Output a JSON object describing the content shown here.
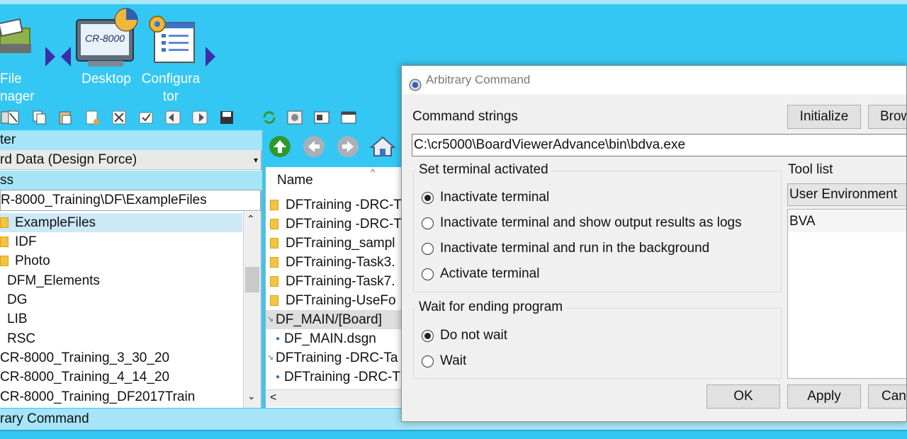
{
  "launcher": {
    "file_manager_label_line1": "File",
    "file_manager_label_line2": "nager",
    "desktop_label": "Desktop",
    "desktop_screen_text": "CR-8000",
    "configurator_label_line1": "Configura",
    "configurator_label_line2": "tor"
  },
  "left_panel": {
    "filter_header": "ter",
    "design_data_combo": "rd Data (Design Force)",
    "address_header": "ss",
    "address_value": "R-8000_Training\\DF\\ExampleFiles",
    "tree_items": [
      {
        "label": "ExampleFiles",
        "selected": true,
        "folder": true
      },
      {
        "label": "IDF",
        "selected": false,
        "folder": true
      },
      {
        "label": "Photo",
        "selected": false,
        "folder": true
      },
      {
        "label": "DFM_Elements",
        "selected": false,
        "folder": false
      },
      {
        "label": "DG",
        "selected": false,
        "folder": false
      },
      {
        "label": "LIB",
        "selected": false,
        "folder": false
      },
      {
        "label": "RSC",
        "selected": false,
        "folder": false
      },
      {
        "label": "CR-8000_Training_3_30_20",
        "selected": false,
        "folder": false
      },
      {
        "label": "CR-8000_Training_4_14_20",
        "selected": false,
        "folder": false
      },
      {
        "label": "CR-8000_Training_DF2017Train",
        "selected": false,
        "folder": false
      }
    ]
  },
  "file_list": {
    "name_header": "Name",
    "rows": [
      "DFTraining -DRC-T",
      "DFTraining -DRC-T",
      "DFTraining_sampl",
      "DFTraining-Task3.",
      "DFTraining-Task7.",
      "DFTraining-UseFo",
      "DF_MAIN/[Board]",
      "DF_MAIN.dsgn",
      "DFTraining -DRC-Ta",
      "DFTraining -DRC-T"
    ],
    "scroll_left": "<"
  },
  "status_bar": {
    "text": "rary Command"
  },
  "dialog": {
    "title": "Arbitrary Command",
    "command_strings_label": "Command strings",
    "initialize_button": "Initialize",
    "browse_button": "Brow",
    "command_value": "C:\\cr5000\\BoardViewerAdvance\\bin\\bdva.exe",
    "terminal_group_title": "Set terminal activated",
    "terminal_options": [
      {
        "label": "Inactivate terminal",
        "checked": true
      },
      {
        "label": "Inactivate terminal and show output results as logs",
        "checked": false
      },
      {
        "label": "Inactivate terminal and run in the background",
        "checked": false
      },
      {
        "label": "Activate terminal",
        "checked": false
      }
    ],
    "wait_group_title": "Wait for ending program",
    "wait_options": [
      {
        "label": "Do not wait",
        "checked": true
      },
      {
        "label": "Wait",
        "checked": false
      }
    ],
    "tool_list_label": "Tool list",
    "tool_list_combo": "User Environment",
    "tool_list_items": [
      "BVA"
    ],
    "ok_button": "OK",
    "apply_button": "Apply",
    "cancel_button": "Can"
  },
  "colors": {
    "background": "#35c7f3",
    "panel_header": "#a6e4f8",
    "selection": "#cde8f7"
  }
}
